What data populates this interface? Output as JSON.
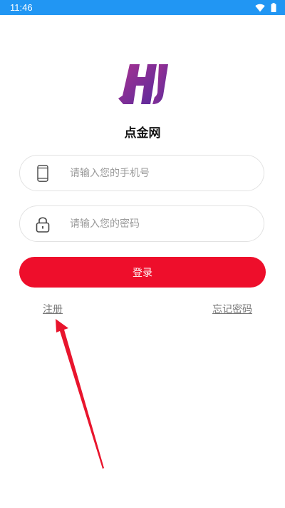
{
  "status_bar": {
    "time": "11:46",
    "icons": [
      "wifi-icon",
      "battery-icon"
    ]
  },
  "app": {
    "name": "点金网",
    "logo": "hj-logo"
  },
  "form": {
    "phone": {
      "icon": "phone-icon",
      "value": "",
      "placeholder": "请输入您的手机号"
    },
    "password": {
      "icon": "lock-icon",
      "value": "",
      "placeholder": "请输入您的密码"
    },
    "login_label": "登录"
  },
  "links": {
    "register": "注册",
    "forgot_password": "忘记密码"
  },
  "colors": {
    "status_bar": "#2196f3",
    "primary": "#ee0e2b",
    "logo_gradient_start": "#a93290",
    "logo_gradient_end": "#5a2a9c",
    "annotation_arrow": "#e8152d"
  }
}
